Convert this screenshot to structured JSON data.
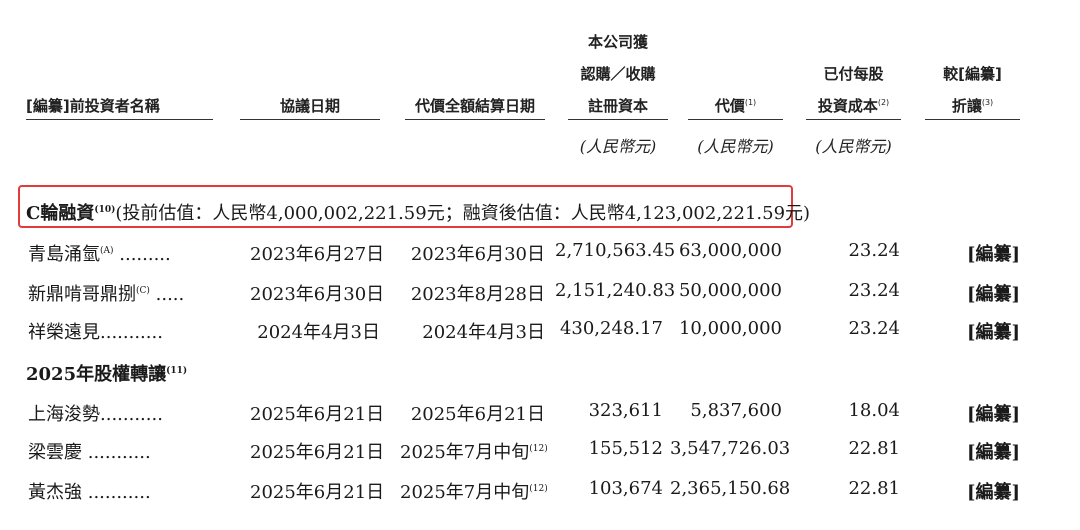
{
  "headers": {
    "name": "[編纂]前投資者名稱",
    "agreement_date": "協議日期",
    "settlement_date": "代價全額結算日期",
    "capital_line1": "本公司獲",
    "capital_line2": "認購／收購",
    "capital_line3": "註冊資本",
    "consideration": "代價",
    "consideration_note": "(1)",
    "cost_line1": "已付每股",
    "cost_line2": "投資成本",
    "cost_note": "(2)",
    "discount_line1": "較[編纂]",
    "discount_line2": "折讓",
    "discount_note": "(3)",
    "unit_capital": "(人民幣元)",
    "unit_consideration": "(人民幣元)",
    "unit_cost": "(人民幣元)"
  },
  "section_c": {
    "title": "C輪融資",
    "note": "(10)",
    "valuation": "(投前估值：人民幣4,000,002,221.59元；融資後估值：人民幣4,123,002,221.59元)"
  },
  "section_2025": {
    "title": "2025年股權轉讓",
    "note": "(11)"
  },
  "rows_c": [
    {
      "name": "青島涌氫",
      "note": "(A)",
      "dots": " .........",
      "date": "2023年6月27日",
      "settle": "2023年6月30日",
      "settle_note": "",
      "capital": "2,710,563.45",
      "price": "63,000,000",
      "cost": "23.24",
      "discount": "[編纂]"
    },
    {
      "name": "新鼎啃哥鼎捌",
      "note": "(C)",
      "dots": " .....",
      "date": "2023年6月30日",
      "settle": "2023年8月28日",
      "settle_note": "",
      "capital": "2,151,240.83",
      "price": "50,000,000",
      "cost": "23.24",
      "discount": "[編纂]"
    },
    {
      "name": "祥榮遠見",
      "note": "",
      "dots": "...........",
      "date": "2024年4月3日",
      "settle": "2024年4月3日",
      "settle_note": "",
      "capital": "430,248.17",
      "price": "10,000,000",
      "cost": "23.24",
      "discount": "[編纂]"
    }
  ],
  "rows_2025": [
    {
      "name": "上海浚勢",
      "note": "",
      "dots": "...........",
      "date": "2025年6月21日",
      "settle": "2025年6月21日",
      "settle_note": "",
      "capital": "323,611",
      "price": "5,837,600",
      "cost": "18.04",
      "discount": "[編纂]"
    },
    {
      "name": "梁雲慶",
      "note": "",
      "dots": " ...........",
      "date": "2025年6月21日",
      "settle": "2025年7月中旬",
      "settle_note": "(12)",
      "capital": "155,512",
      "price": "3,547,726.03",
      "cost": "22.81",
      "discount": "[編纂]"
    },
    {
      "name": "黃杰強",
      "note": "",
      "dots": " ...........",
      "date": "2025年6月21日",
      "settle": "2025年7月中旬",
      "settle_note": "(12)",
      "capital": "103,674",
      "price": "2,365,150.68",
      "cost": "22.81",
      "discount": "[編纂]"
    }
  ],
  "colors": {
    "highlight_border": "#e23b3b",
    "text": "#1a1a1a"
  }
}
